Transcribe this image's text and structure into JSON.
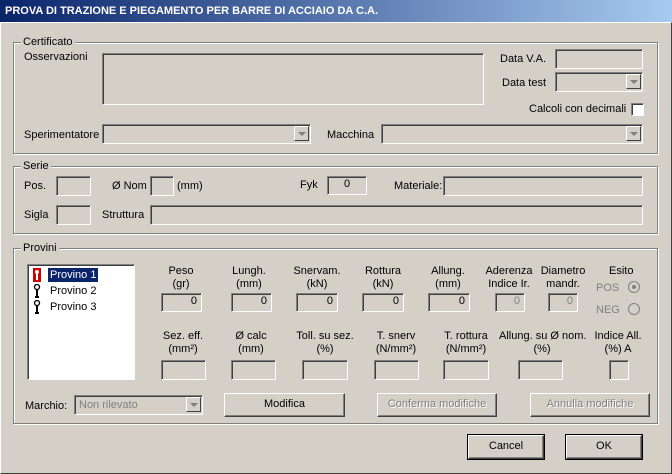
{
  "window": {
    "title": "PROVA DI TRAZIONE E PIEGAMENTO PER BARRE DI ACCIAIO DA C.A."
  },
  "certificato": {
    "legend": "Certificato",
    "osservazioni_label": "Osservazioni",
    "data_va_label": "Data V.A.",
    "data_test_label": "Data test",
    "calcoli_label": "Calcoli con decimali",
    "sperimentatore_label": "Sperimentatore",
    "macchina_label": "Macchina"
  },
  "serie": {
    "legend": "Serie",
    "pos_label": "Pos.",
    "onom_label": "Ø Nom",
    "mm_label": "(mm)",
    "fyk_label": "Fyk",
    "fyk_value": "0",
    "materiale_label": "Materiale:",
    "sigla_label": "Sigla",
    "struttura_label": "Struttura"
  },
  "provini": {
    "legend": "Provini",
    "items": [
      {
        "label": "Provino 1",
        "icon": "specimen-red-icon",
        "selected": true
      },
      {
        "label": "Provino 2",
        "icon": "specimen-icon",
        "selected": false
      },
      {
        "label": "Provino 3",
        "icon": "specimen-icon",
        "selected": false
      }
    ],
    "row1": [
      {
        "l1": "Peso",
        "l2": "(gr)",
        "value": "0",
        "disabled": false
      },
      {
        "l1": "Lungh.",
        "l2": "(mm)",
        "value": "0",
        "disabled": false
      },
      {
        "l1": "Snervam.",
        "l2": "(kN)",
        "value": "0",
        "disabled": false
      },
      {
        "l1": "Rottura",
        "l2": "(kN)",
        "value": "0",
        "disabled": false
      },
      {
        "l1": "Allung.",
        "l2": "(mm)",
        "value": "0",
        "disabled": false
      },
      {
        "l1": "Aderenza",
        "l2": "Indice Ir.",
        "value": "0",
        "disabled": true
      },
      {
        "l1": "Diametro",
        "l2": "mandr.",
        "value": "0",
        "disabled": true
      }
    ],
    "esito_label": "Esito",
    "pos_label": "POS",
    "neg_label": "NEG",
    "row2": [
      {
        "l1": "Sez. eff.",
        "l2": "(mm²)"
      },
      {
        "l1": "Ø calc",
        "l2": "(mm)"
      },
      {
        "l1": "Toll. su sez.",
        "l2": "(%)"
      },
      {
        "l1": "T. snerv",
        "l2": "(N/mm²)"
      },
      {
        "l1": "T. rottura",
        "l2": "(N/mm²)"
      },
      {
        "l1": "Allung. su Ø nom.",
        "l2": "(%)"
      },
      {
        "l1": "Indice All.",
        "l2": "(%) A"
      }
    ],
    "marchio_label": "Marchio:",
    "marchio_value": "Non rilevato",
    "modifica_label": "Modifica",
    "conferma_label": "Conferma modifiche",
    "annulla_label": "Annulla modifiche"
  },
  "footer": {
    "cancel_label": "Cancel",
    "ok_label": "OK"
  }
}
